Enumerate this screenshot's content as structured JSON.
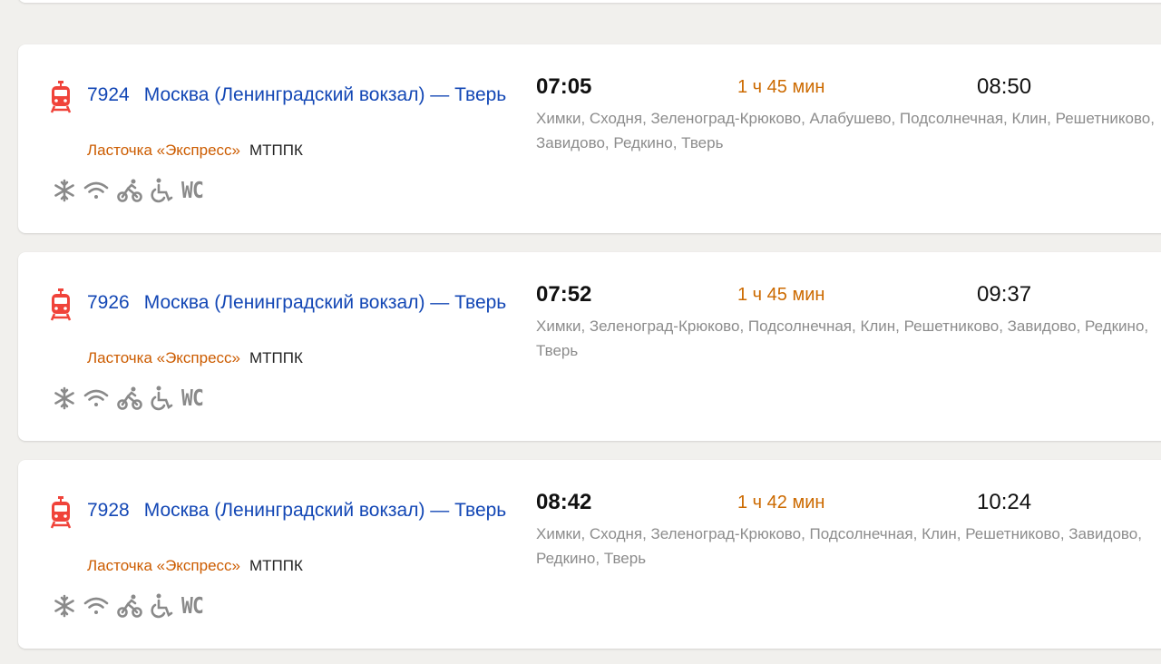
{
  "colors": {
    "background": "#f1f0ed",
    "link": "#1347b5",
    "brand": "#cc5c00",
    "duration": "#cc6a00",
    "train_icon": "#f0433a",
    "muted": "#8c8c8c"
  },
  "amenity_icons": [
    "snowflake-icon",
    "wifi-icon",
    "bicycle-icon",
    "wheelchair-icon",
    "wc-icon"
  ],
  "trains": [
    {
      "number": "7924",
      "route": "Москва (Ленинградский вокзал) — Тверь",
      "brand": "Ласточка «Экспресс»",
      "carrier": "МТППК",
      "departure": "07:05",
      "duration": "1 ч 45 мин",
      "arrival": "08:50",
      "stops": "Химки, Сходня, Зеленоград-Крюково, Алабушево, Подсолнечная, Клин, Решетниково, Завидово, Редкино, Тверь",
      "wc_label": "WC"
    },
    {
      "number": "7926",
      "route": "Москва (Ленинградский вокзал) — Тверь",
      "brand": "Ласточка «Экспресс»",
      "carrier": "МТППК",
      "departure": "07:52",
      "duration": "1 ч 45 мин",
      "arrival": "09:37",
      "stops": "Химки, Зеленоград-Крюково, Подсолнечная, Клин, Решетниково, Завидово, Редкино, Тверь",
      "wc_label": "WC"
    },
    {
      "number": "7928",
      "route": "Москва (Ленинградский вокзал) — Тверь",
      "brand": "Ласточка «Экспресс»",
      "carrier": "МТППК",
      "departure": "08:42",
      "duration": "1 ч 42 мин",
      "arrival": "10:24",
      "stops": "Химки, Сходня, Зеленоград-Крюково, Подсолнечная, Клин, Решетниково, Завидово, Редкино, Тверь",
      "wc_label": "WC"
    }
  ]
}
